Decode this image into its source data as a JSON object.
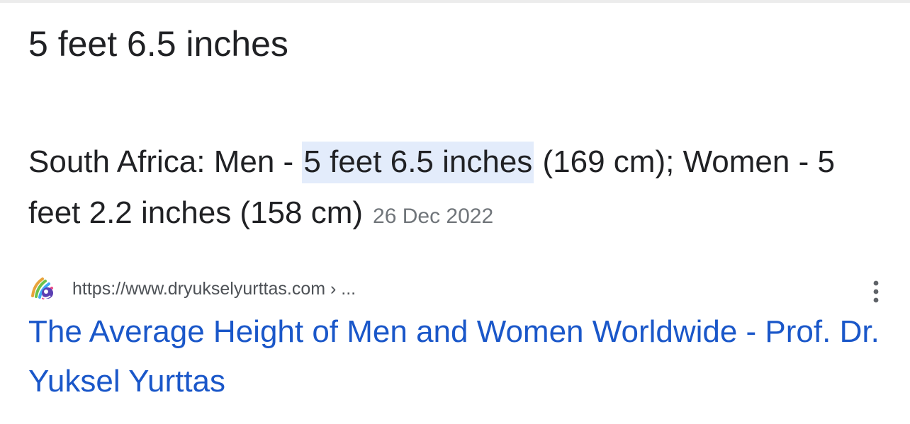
{
  "answer": {
    "text": "5 feet 6.5 inches"
  },
  "snippet": {
    "prefix": "South Africa: Men - ",
    "highlight": "5 feet 6.5 inches",
    "suffix": " (169 cm); Women - 5 feet 2.2 inches (158 cm)",
    "date": "26 Dec 2022",
    "highlight_color": "#e3ecfb"
  },
  "result": {
    "url": "https://www.dryukselyurttas.com › ...",
    "title": "The Average Height of Men and Women Worldwide - Prof. Dr. Yuksel Yurttas",
    "title_color": "#1a57c9",
    "favicon": "site-logo-icon",
    "menu_icon": "more-vert-icon"
  }
}
